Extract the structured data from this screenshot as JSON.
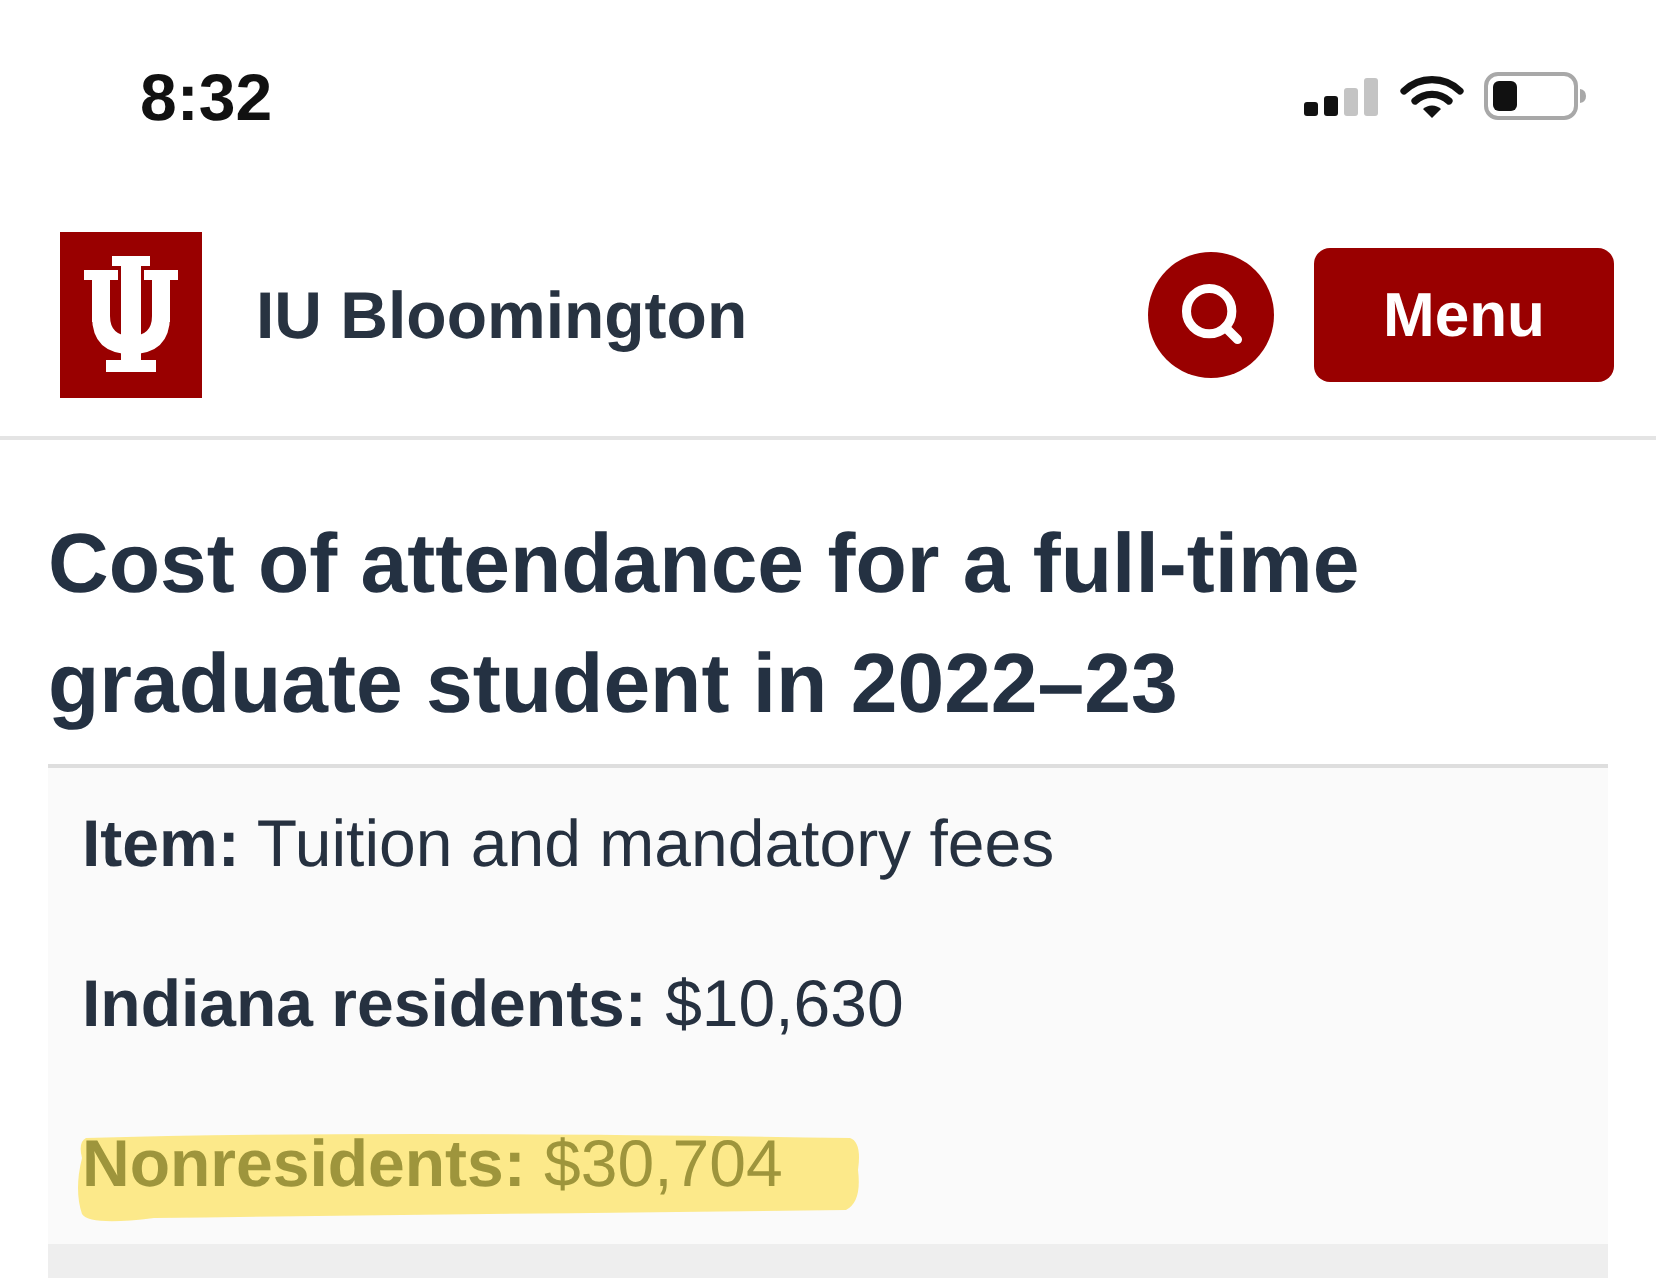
{
  "status_bar": {
    "time": "8:32"
  },
  "header": {
    "site_name": "IU Bloomington",
    "menu_button": "Menu"
  },
  "page": {
    "title": "Cost of attendance for a full-time graduate student in 2022–23"
  },
  "cost_items": [
    {
      "label": "Item:",
      "value": "Tuition and mandatory fees",
      "highlighted": false
    },
    {
      "label": "Indiana residents:",
      "value": "$10,630",
      "highlighted": false
    },
    {
      "label": "Nonresidents:",
      "value": "$30,704",
      "highlighted": true
    }
  ]
}
